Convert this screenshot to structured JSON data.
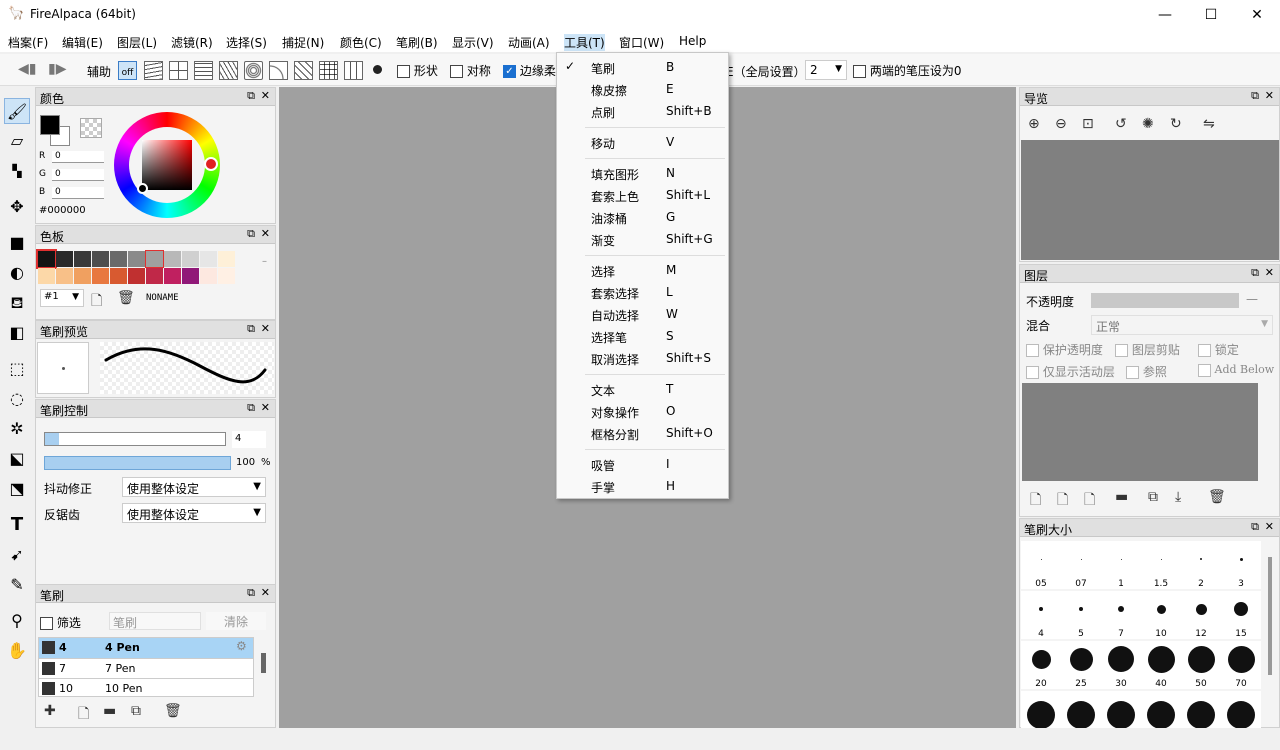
{
  "window": {
    "title": "FireAlpaca (64bit)",
    "minimize": "—",
    "maximize": "☐",
    "close": "✕"
  },
  "menu": [
    "档案(F)",
    "编辑(E)",
    "图层(L)",
    "滤镜(R)",
    "选择(S)",
    "捕捉(N)",
    "颜色(C)",
    "笔刷(B)",
    "显示(V)",
    "动画(A)",
    "工具(T)",
    "窗口(W)",
    "Help"
  ],
  "toolbar": {
    "assist_label": "辅助",
    "off_label": "off",
    "shape_label": "形状",
    "symmetric_label": "对称",
    "edge_label": "边缘柔",
    "pressure_global_label": "E（全局设置）",
    "pressure_value": "2",
    "both_ends_label": "两端的笔压设为0"
  },
  "tools_menu": {
    "items": [
      {
        "label": "笔刷",
        "shortcut": "B",
        "checked": true
      },
      {
        "label": "橡皮擦",
        "shortcut": "E"
      },
      {
        "label": "点刷",
        "shortcut": "Shift+B"
      },
      {
        "sep": true
      },
      {
        "label": "移动",
        "shortcut": "V"
      },
      {
        "sep": true
      },
      {
        "label": "填充图形",
        "shortcut": "N"
      },
      {
        "label": "套索上色",
        "shortcut": "Shift+L"
      },
      {
        "label": "油漆桶",
        "shortcut": "G"
      },
      {
        "label": "渐变",
        "shortcut": "Shift+G"
      },
      {
        "sep": true
      },
      {
        "label": "选择",
        "shortcut": "M"
      },
      {
        "label": "套索选择",
        "shortcut": "L"
      },
      {
        "label": "自动选择",
        "shortcut": "W"
      },
      {
        "label": "选择笔",
        "shortcut": "S"
      },
      {
        "label": "取消选择",
        "shortcut": "Shift+S"
      },
      {
        "sep": true
      },
      {
        "label": "文本",
        "shortcut": "T"
      },
      {
        "label": "对象操作",
        "shortcut": "O"
      },
      {
        "label": "框格分割",
        "shortcut": "Shift+O"
      },
      {
        "sep": true
      },
      {
        "label": "吸管",
        "shortcut": "I"
      },
      {
        "label": "手掌",
        "shortcut": "H"
      }
    ]
  },
  "color_panel": {
    "title": "颜色",
    "r_label": "R",
    "g_label": "G",
    "b_label": "B",
    "r": "0",
    "g": "0",
    "b": "0",
    "hex": "#000000"
  },
  "palette_panel": {
    "title": "色板",
    "index": "#1",
    "name": "NONAME",
    "row1": [
      "#141414",
      "#2a2a2a",
      "#3a3a3a",
      "#4e4e4e",
      "#6a6a6a",
      "#8a8a8a",
      "#a0a0a0",
      "#b8b8b8",
      "#d0d0d0",
      "#e6e6e6",
      "#fef0d8"
    ],
    "row2": [
      "#fcd8a8",
      "#f8c088",
      "#f0a060",
      "#e87840",
      "#d85a30",
      "#c03030",
      "#c02848",
      "#c02060",
      "#901878",
      "#fde8e0",
      "#fff0e4"
    ]
  },
  "brush_preview": {
    "title": "笔刷预览"
  },
  "brush_control": {
    "title": "笔刷控制",
    "size": "4",
    "opacity": "100",
    "opacity_unit": "%",
    "stabilizer_label": "抖动修正",
    "stabilizer_value": "使用整体设定",
    "antialias_label": "反锯齿",
    "antialias_value": "使用整体设定"
  },
  "brush_panel": {
    "title": "笔刷",
    "filter_label": "筛选",
    "filter_placeholder": "笔刷",
    "clear_label": "清除",
    "items": [
      {
        "size": "4",
        "name": "4 Pen"
      },
      {
        "size": "7",
        "name": "7 Pen"
      },
      {
        "size": "10",
        "name": "10 Pen"
      }
    ]
  },
  "navigator": {
    "title": "导览"
  },
  "layers": {
    "title": "图层",
    "opacity_label": "不透明度",
    "opacity_value": "—",
    "blend_label": "混合",
    "blend_value": "正常",
    "protect_alpha": "保护透明度",
    "clipping": "图层剪贴",
    "lock": "锁定",
    "show_active_only": "仅显示活动层",
    "reference": "参照",
    "add_below": "Add Below"
  },
  "brush_size": {
    "title": "笔刷大小",
    "sizes": [
      "05",
      "07",
      "1",
      "1.5",
      "2",
      "3",
      "4",
      "5",
      "7",
      "10",
      "12",
      "15",
      "20",
      "25",
      "30",
      "40",
      "50",
      "70",
      "",
      "",
      "",
      "",
      "",
      ""
    ]
  }
}
